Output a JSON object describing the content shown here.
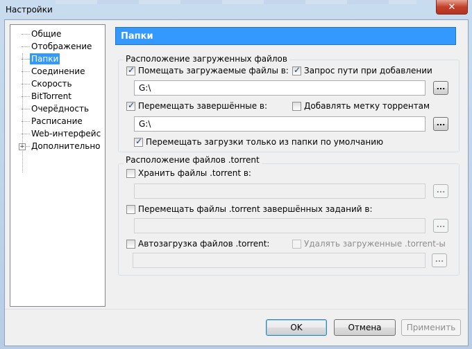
{
  "window": {
    "title": "Настройки",
    "close_glyph": "✕"
  },
  "sidebar": {
    "items": [
      {
        "label": "Общие"
      },
      {
        "label": "Отображение"
      },
      {
        "label": "Папки"
      },
      {
        "label": "Соединение"
      },
      {
        "label": "Скорость"
      },
      {
        "label": "BitTorrent"
      },
      {
        "label": "Очерёдность"
      },
      {
        "label": "Расписание"
      },
      {
        "label": "Web-интерфейс"
      },
      {
        "label": "Дополнительно"
      }
    ],
    "selected": "Папки",
    "expander_glyph": "+"
  },
  "page": {
    "title": "Папки",
    "downloads_group": {
      "title": "Расположение загруженных файлов",
      "save_files_label": "Помещать загружаемые файлы в:",
      "save_files_checked": true,
      "ask_path_label": "Запрос пути при добавлении",
      "ask_path_checked": true,
      "save_path": "G:\\",
      "move_completed_label": "Перемещать завершённые в:",
      "move_completed_checked": true,
      "add_label_label": "Добавлять метку торрентам",
      "add_label_checked": false,
      "completed_path": "G:\\",
      "only_default_label": "Перемещать загрузки только из папки по умолчанию",
      "only_default_checked": true
    },
    "torrent_group": {
      "title": "Расположение файлов .torrent",
      "store_label": "Хранить файлы .torrent в:",
      "store_checked": false,
      "store_path": "",
      "move_torrent_label": "Перемещать файлы .torrent завершённых заданий в:",
      "move_torrent_checked": false,
      "move_torrent_path": "",
      "autoload_label": "Автозагрузка файлов .torrent:",
      "autoload_checked": false,
      "delete_loaded_label": "Удалять загруженные .torrent-ы",
      "delete_loaded_checked": false,
      "autoload_path": ""
    },
    "browse_label": "..."
  },
  "buttons": {
    "ok": "OK",
    "cancel": "Отмена",
    "apply": "Применить"
  }
}
